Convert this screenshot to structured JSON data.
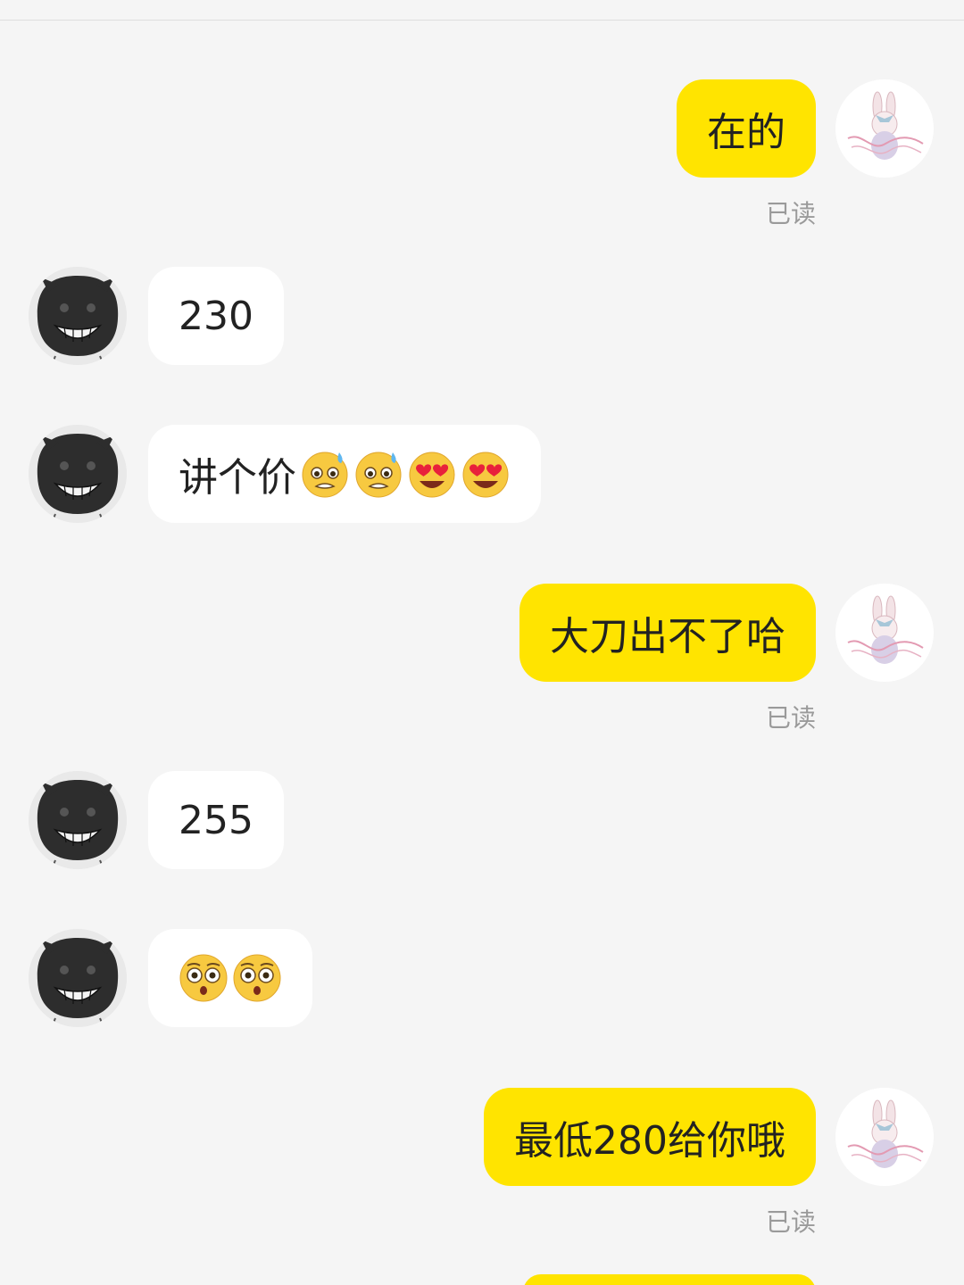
{
  "messages": [
    {
      "side": "out",
      "text": "在的",
      "read_label": "已读"
    },
    {
      "side": "in",
      "text": "230"
    },
    {
      "side": "in",
      "text": "讲个价",
      "emojis": [
        "anxious-sweat-emoji",
        "anxious-sweat-emoji",
        "heart-eyes-emoji",
        "heart-eyes-emoji"
      ]
    },
    {
      "side": "out",
      "text": "大刀出不了哈",
      "read_label": "已读"
    },
    {
      "side": "in",
      "text": "255"
    },
    {
      "side": "in",
      "text": "",
      "emojis": [
        "flushed-emoji",
        "flushed-emoji"
      ]
    },
    {
      "side": "out",
      "text": "最低280给你哦",
      "read_label": "已读"
    }
  ],
  "colors": {
    "background": "#f5f5f5",
    "outgoing_bubble": "#ffe400",
    "incoming_bubble": "#ffffff",
    "read_text": "#9a9a9a"
  }
}
